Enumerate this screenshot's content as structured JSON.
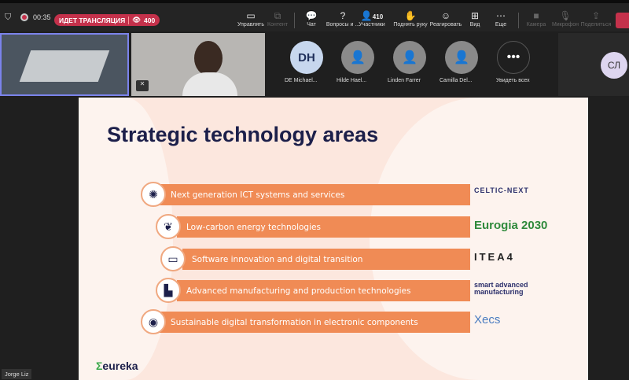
{
  "topbar": {
    "timer": "00:35",
    "live_label": "ИДЕТ ТРАНСЛЯЦИЯ",
    "viewers": "400",
    "buttons": [
      {
        "label": "Управлять",
        "icon": "share-screen-icon"
      },
      {
        "label": "Контент",
        "icon": "content-icon"
      },
      {
        "label": "Чат",
        "icon": "chat-icon"
      },
      {
        "label": "Вопросы и ...",
        "icon": "qa-icon"
      },
      {
        "label": "Участники",
        "icon": "people-icon",
        "count": "410"
      },
      {
        "label": "Поднять руку",
        "icon": "hand-icon"
      },
      {
        "label": "Реагировать",
        "icon": "smile-icon"
      },
      {
        "label": "Вид",
        "icon": "grid-icon"
      },
      {
        "label": "Еще",
        "icon": "more-icon"
      },
      {
        "label": "Камера",
        "icon": "camera-icon"
      },
      {
        "label": "Микрофон",
        "icon": "mic-icon"
      },
      {
        "label": "Поделиться",
        "icon": "share-icon"
      }
    ]
  },
  "participants": [
    {
      "initials": "DH",
      "name": "DE Michael..."
    },
    {
      "name": "Hilde Hael..."
    },
    {
      "name": "Linden Farrer"
    },
    {
      "name": "Camilla Del..."
    }
  ],
  "see_all": "Увидеть всех",
  "right_avatar": "СЛ",
  "speaker_label": "Jorge Liz",
  "slide": {
    "title": "Strategic technology areas",
    "items": [
      "Next generation ICT systems and services",
      "Low-carbon energy technologies",
      "Software innovation and digital transition",
      "Advanced manufacturing and production technologies",
      "Sustainable digital transformation in electronic components"
    ],
    "logos": [
      "CELTIC-NEXT",
      "Eurogia 2030",
      "ITEA4",
      "smart advanced manufacturing",
      "Xecs"
    ],
    "footer_logo": "eureka"
  },
  "colors": {
    "bar": "#f08b55",
    "title": "#1c1f4a",
    "live": "#c4314b"
  }
}
